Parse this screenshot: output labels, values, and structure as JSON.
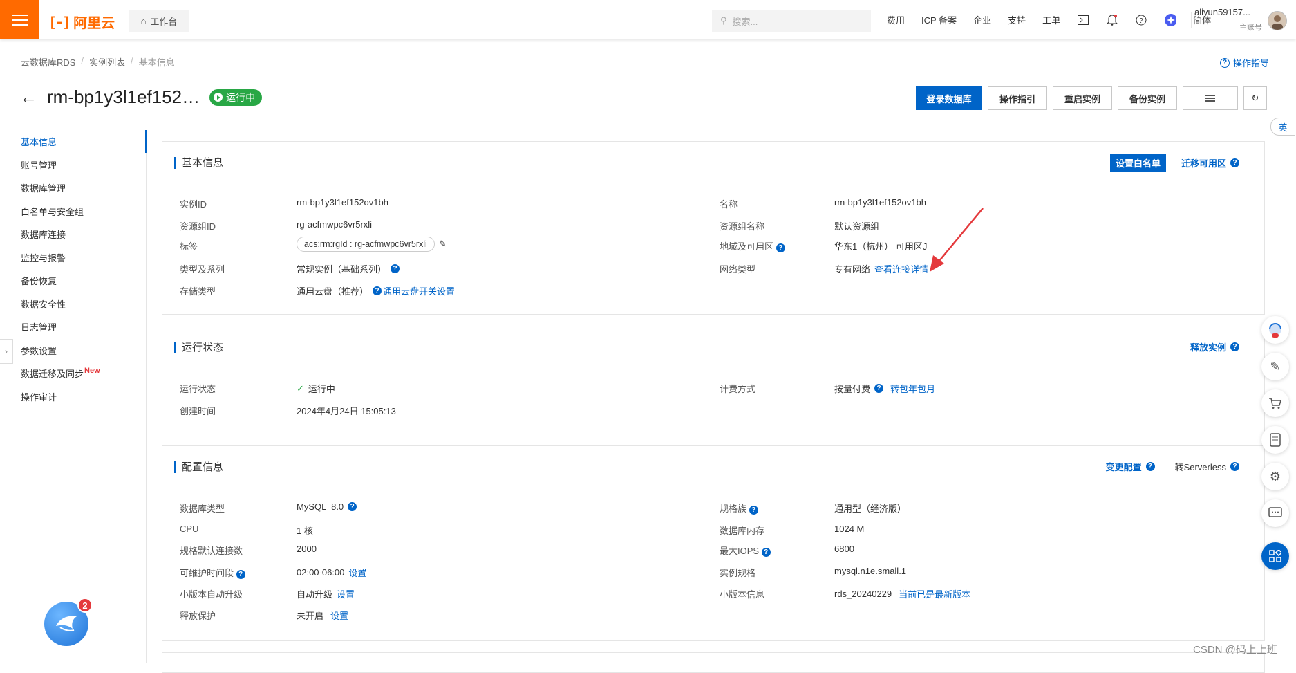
{
  "topbar": {
    "logo_text": "阿里云",
    "workbench": "工作台",
    "search_placeholder": "搜索...",
    "nav": [
      "费用",
      "ICP 备案",
      "企业",
      "支持",
      "工单"
    ],
    "lang": "简体",
    "user_name": "aliyun59157...",
    "user_role": "主账号"
  },
  "breadcrumb": [
    "云数据库RDS",
    "实例列表",
    "基本信息"
  ],
  "guide_link": "操作指导",
  "instance": {
    "title": "rm-bp1y3l1ef152…",
    "status": "运行中"
  },
  "actions": {
    "login": "登录数据库",
    "guide": "操作指引",
    "restart": "重启实例",
    "backup": "备份实例"
  },
  "sidebar": {
    "items": [
      "基本信息",
      "账号管理",
      "数据库管理",
      "白名单与安全组",
      "数据库连接",
      "监控与报警",
      "备份恢复",
      "数据安全性",
      "日志管理",
      "参数设置",
      "数据迁移及同步",
      "操作审计"
    ],
    "new_badge": "New"
  },
  "basic": {
    "title": "基本信息",
    "set_whitelist": "设置白名单",
    "migrate_zone": "迁移可用区",
    "instance_id_label": "实例ID",
    "instance_id": "rm-bp1y3l1ef152ov1bh",
    "rg_id_label": "资源组ID",
    "rg_id": "rg-acfmwpc6vr5rxli",
    "tag_label": "标签",
    "tag": "acs:rm:rgId : rg-acfmwpc6vr5rxli",
    "type_label": "类型及系列",
    "type": "常规实例（基础系列）",
    "storage_label": "存储类型",
    "storage": "通用云盘（推荐）",
    "storage_link": "通用云盘开关设置",
    "name_label": "名称",
    "name": "rm-bp1y3l1ef152ov1bh",
    "rg_name_label": "资源组名称",
    "rg_name": "默认资源组",
    "region_label": "地域及可用区",
    "region": "华东1（杭州） 可用区J",
    "network_label": "网络类型",
    "network": "专有网络",
    "network_link": "查看连接详情"
  },
  "running": {
    "title": "运行状态",
    "release": "释放实例",
    "state_label": "运行状态",
    "state": "运行中",
    "created_label": "创建时间",
    "created": "2024年4月24日 15:05:13",
    "billing_label": "计费方式",
    "billing": "按量付费",
    "billing_link": "转包年包月"
  },
  "config": {
    "title": "配置信息",
    "change": "变更配置",
    "serverless": "转Serverless",
    "db_type_label": "数据库类型",
    "db_type": "MySQL  8.0",
    "cpu_label": "CPU",
    "cpu": "1 核",
    "conn_label": "规格默认连接数",
    "conn": "2000",
    "maint_label": "可维护时间段",
    "maint": "02:00-06:00",
    "maint_link": "设置",
    "upgrade_label": "小版本自动升级",
    "upgrade": "自动升级",
    "upgrade_link": "设置",
    "protect_label": "释放保护",
    "protect": "未开启",
    "protect_link": "设置",
    "family_label": "规格族",
    "family": "通用型（经济版）",
    "mem_label": "数据库内存",
    "mem": "1024 M",
    "iops_label": "最大IOPS",
    "iops": "6800",
    "spec_label": "实例规格",
    "spec": "mysql.n1e.small.1",
    "minor_label": "小版本信息",
    "minor": "rds_20240229",
    "minor_link": "当前已是最新版本"
  },
  "float": {
    "lang_toggle": "英",
    "notify_count": "2"
  },
  "watermark": "CSDN @码上上班",
  "colors": {
    "brand": "#ff6a00",
    "primary": "#0064c8",
    "success": "#28a745",
    "arrow": "#e4393c"
  }
}
